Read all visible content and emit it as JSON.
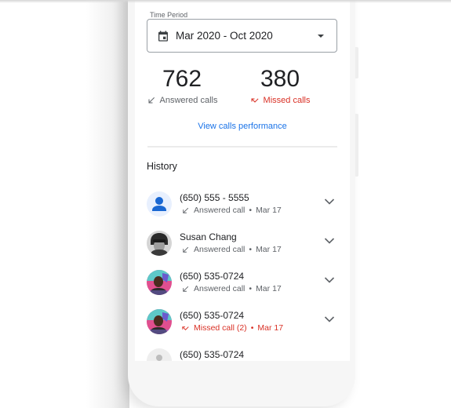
{
  "time_period": {
    "label": "Time Period",
    "value": "Mar 2020 - Oct 2020",
    "icon": "calendar-icon"
  },
  "stats": {
    "answered": {
      "count": "762",
      "label": "Answered calls",
      "icon": "call-received-icon"
    },
    "missed": {
      "count": "380",
      "label": "Missed calls",
      "icon": "call-missed-icon"
    }
  },
  "view_performance_link": "View calls performance",
  "history": {
    "title": "History",
    "items": [
      {
        "title": "(650) 555 - 5555",
        "status": "Answered call",
        "date": "Mar 17",
        "type": "answered",
        "avatar": "default-person"
      },
      {
        "title": "Susan Chang",
        "status": "Answered call",
        "date": "Mar 17",
        "type": "answered",
        "avatar": "photo-susan"
      },
      {
        "title": "(650) 535-0724",
        "status": "Answered call",
        "date": "Mar 17",
        "type": "answered",
        "avatar": "photo-man"
      },
      {
        "title": "(650) 535-0724",
        "status": "Missed call (2)",
        "date": "Mar 17",
        "type": "missed",
        "avatar": "photo-man"
      },
      {
        "title": "(650) 535-0724",
        "status": "",
        "date": "",
        "type": "partial",
        "avatar": "gray-placeholder"
      }
    ]
  },
  "colors": {
    "accent_blue": "#1a73e8",
    "missed_red": "#d93025",
    "text_primary": "#202124",
    "text_secondary": "#5f6368"
  }
}
